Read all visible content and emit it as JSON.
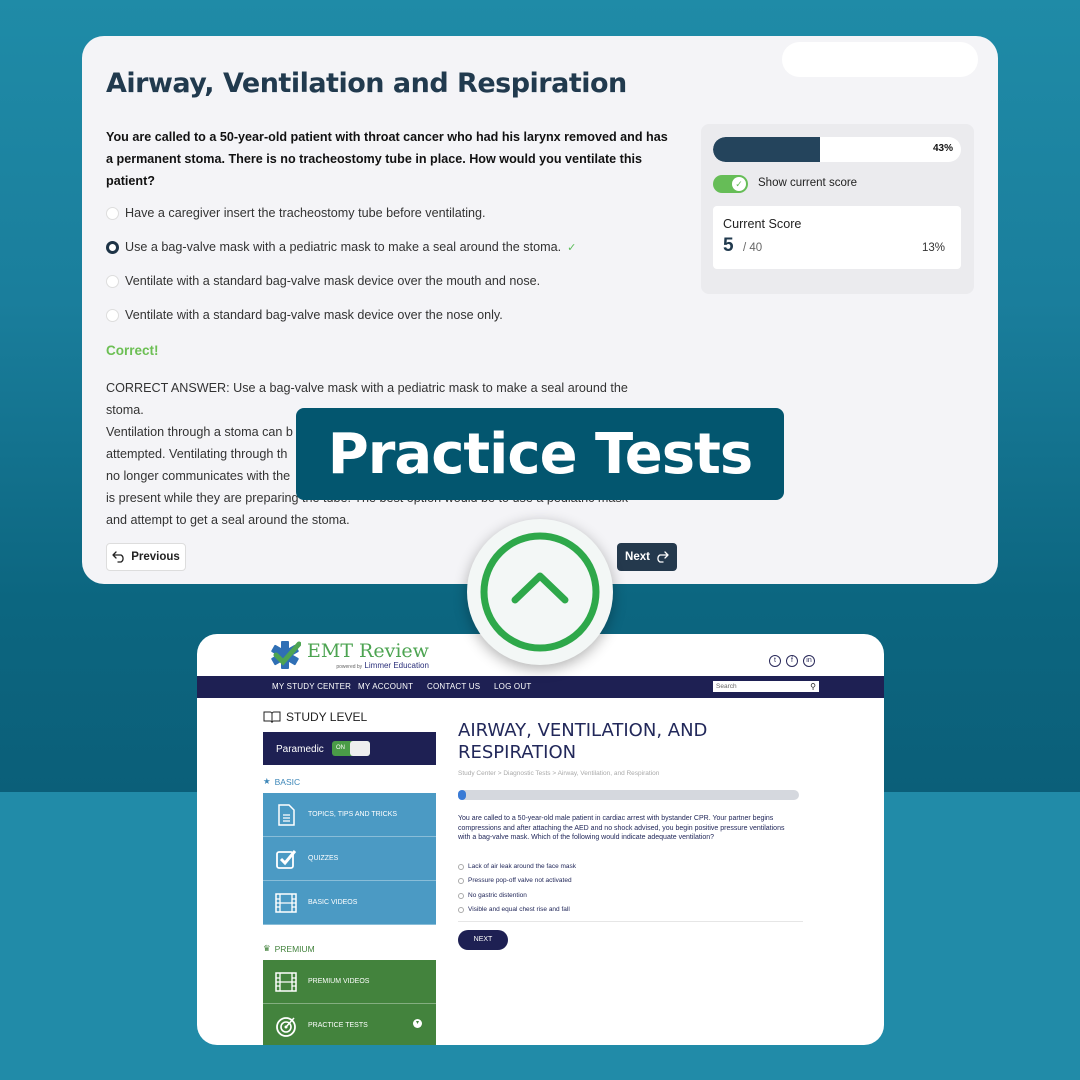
{
  "quiz_card": {
    "title": "Airway, Ventilation and Respiration",
    "question": "You are called to a 50-year-old patient with throat cancer who had his larynx removed and has a permanent stoma. There is no tracheostomy tube in place. How would you ventilate this patient?",
    "options": [
      {
        "label": "Have a caregiver insert the tracheostomy tube before ventilating.",
        "selected": false
      },
      {
        "label": "Use a bag-valve mask with a pediatric mask to make a seal around the stoma.",
        "selected": true,
        "correct_mark": "✓"
      },
      {
        "label": "Ventilate with a standard bag-valve mask device over the mouth and nose.",
        "selected": false
      },
      {
        "label": "Ventilate with a standard bag-valve mask device over the nose only.",
        "selected": false
      }
    ],
    "feedback": "Correct!",
    "explanation_lines": [
      "CORRECT ANSWER: Use a bag-valve mask with a pediatric mask to make a seal around the",
      "stoma.",
      "Ventilation through a stoma can b",
      "attempted. Ventilating through th",
      "no longer communicates with the",
      "is present while they are preparing the tube. The best option would be to use a pediatric mask",
      "and attempt to get a seal around the stoma."
    ],
    "prev_label": "Previous",
    "next_label": "Next",
    "progress": {
      "percent": 43,
      "label": "43%"
    },
    "show_score_label": "Show current score",
    "show_score_on": true,
    "score": {
      "title": "Current Score",
      "value": "5",
      "total": "/ 40",
      "percent": "13%"
    }
  },
  "banner": {
    "text": "Practice Tests"
  },
  "scroll_up": {
    "icon": "chevron-up"
  },
  "site": {
    "logo_title": "EMT Review",
    "logo_powered": "powered by",
    "logo_company": "Limmer Education",
    "social": [
      "twitter",
      "facebook",
      "linkedin"
    ],
    "nav": [
      "MY STUDY CENTER",
      "MY ACCOUNT",
      "CONTACT US",
      "LOG OUT"
    ],
    "search_placeholder": "Search",
    "study_level_label": "STUDY LEVEL",
    "paramedic_label": "Paramedic",
    "toggle_label": "ON",
    "basic_label": "BASIC",
    "basic_items": [
      "TOPICS, TIPS AND TRICKS",
      "QUIZZES",
      "BASIC VIDEOS"
    ],
    "premium_label": "PREMIUM",
    "premium_items": [
      "PREMIUM VIDEOS",
      "PRACTICE TESTS"
    ],
    "page_title": "AIRWAY, VENTILATION, AND RESPIRATION",
    "breadcrumb": "Study Center > Diagnostic Tests > Airway, Ventilation, and Respiration",
    "progress_percent": 0,
    "question": "You are called to a 50-year-old male patient in cardiac arrest with bystander CPR. Your partner begins compressions and after attaching the AED and no shock advised, you begin positive pressure ventilations with a bag-valve mask. Which of the following would indicate adequate ventilation?",
    "options": [
      "Lack of air leak around the face mask",
      "Pressure pop-off valve not activated",
      "No gastric distention",
      "Visible and equal chest rise and fall"
    ],
    "next_label": "NEXT"
  },
  "colors": {
    "accent_navy": "#24394d",
    "correct_green": "#6cbf54",
    "banner": "#03566f",
    "site_nav": "#1e2053",
    "basic_blue": "#4b9ac4",
    "premium_green": "#43833d"
  }
}
